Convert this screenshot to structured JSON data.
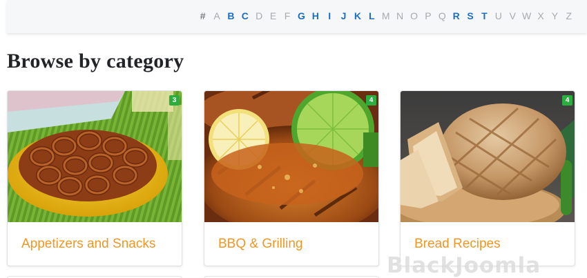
{
  "alphabet": {
    "letters": [
      "#",
      "A",
      "B",
      "C",
      "D",
      "E",
      "F",
      "G",
      "H",
      "I",
      "J",
      "K",
      "L",
      "M",
      "N",
      "O",
      "P",
      "Q",
      "R",
      "S",
      "T",
      "U",
      "V",
      "W",
      "X",
      "Y",
      "Z"
    ],
    "active": [
      "B",
      "C",
      "G",
      "H",
      "I",
      "J",
      "K",
      "L",
      "R",
      "S",
      "T"
    ]
  },
  "heading": "Browse by category",
  "categories": [
    {
      "title": "Appetizers and Snacks",
      "count": "3",
      "image": "pretzels-bowl"
    },
    {
      "title": "BBQ & Grilling",
      "count": "4",
      "image": "grilled-chicken-lime"
    },
    {
      "title": "Bread Recipes",
      "count": "4",
      "image": "bread-loaf"
    }
  ],
  "watermark": "BlackJoomla",
  "colors": {
    "accent": "#f09723",
    "link_active": "#1a6fc4",
    "badge": "#2bae3f"
  }
}
